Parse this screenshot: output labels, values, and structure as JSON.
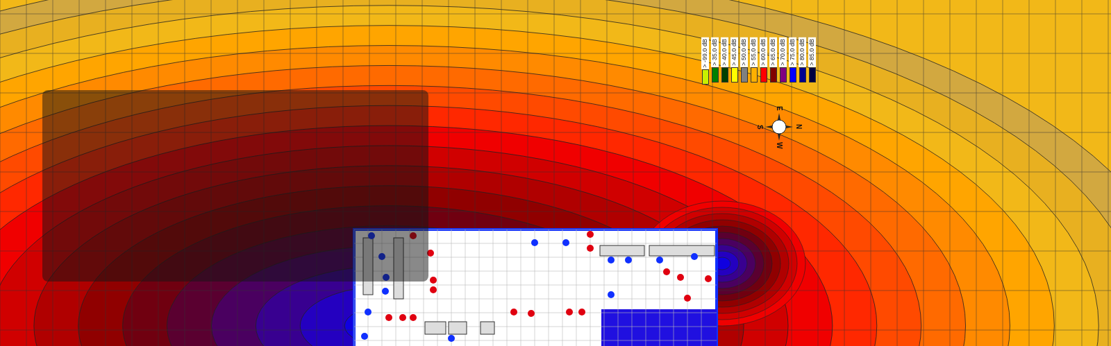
{
  "legend": [
    {
      "label": "> -99.0 dB",
      "color": "#c8f000"
    },
    {
      "label": "> 35.0 dB",
      "color": "#008000"
    },
    {
      "label": "> 40.0 dB",
      "color": "#004000"
    },
    {
      "label": "> 45.0 dB",
      "color": "#ffff00"
    },
    {
      "label": "> 50.0 dB",
      "color": "#808080"
    },
    {
      "label": "> 55.0 dB",
      "color": "#ffb000"
    },
    {
      "label": "> 60.0 dB",
      "color": "#ff0000"
    },
    {
      "label": "> 65.0 dB",
      "color": "#800000"
    },
    {
      "label": "> 70.0 dB",
      "color": "#800080"
    },
    {
      "label": "> 75.0 dB",
      "color": "#0000ff"
    },
    {
      "label": "> 80.0 dB",
      "color": "#000090"
    },
    {
      "label": "> 85.0 dB",
      "color": "#000040"
    }
  ],
  "compass": {
    "north": "N",
    "east": "E",
    "south": "S",
    "west": "W"
  }
}
